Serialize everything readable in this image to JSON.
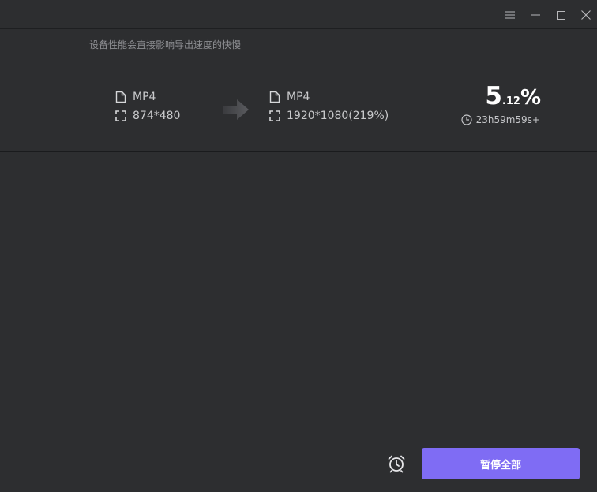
{
  "window": {
    "controls": [
      "menu-icon",
      "minimize-icon",
      "maximize-icon",
      "close-icon"
    ]
  },
  "task": {
    "notice": "设备性能会直接影响导出速度的快慢",
    "source": {
      "format": "MP4",
      "resolution": "874*480"
    },
    "target": {
      "format": "MP4",
      "resolution": "1920*1080(219%)"
    },
    "progress": {
      "integer": "5",
      "decimal": ".12",
      "sign": "%",
      "value_percent": 5.12
    },
    "remaining_time": "23h59m59s+"
  },
  "footer": {
    "alarm_icon": "alarm-clock-icon",
    "pause_all_label": "暂停全部"
  },
  "colors": {
    "background": "#2d2e30",
    "accent": "#7f6cf4",
    "text": "#c9cacc",
    "muted": "#8e8f93"
  }
}
